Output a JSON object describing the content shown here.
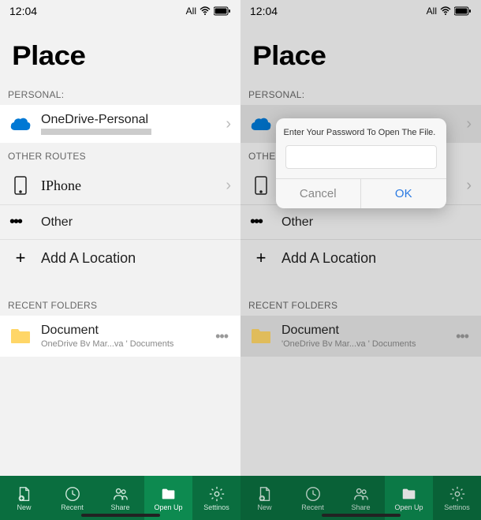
{
  "status": {
    "time": "12:04",
    "network_label": "All"
  },
  "title": "Place",
  "sections": {
    "personal": "PERSONAL:",
    "other_routes": "OTHER ROUTES",
    "recent": "RECENT FOLDERS"
  },
  "personal_item": {
    "title": "OneDrive-Personal"
  },
  "routes": {
    "iphone": "IPhone",
    "other": "Other",
    "add": "Add A Location"
  },
  "recent_item": {
    "title": "Document",
    "path": "OneDrive Bv Mar...va ' Documents",
    "path_right": "'OneDrive Bv Mar...va ' Documents"
  },
  "tabs": {
    "new": "New",
    "recent": "Recent",
    "share": "Share",
    "open": "Open Up",
    "settings": "Settinos"
  },
  "right_sections": {
    "other_routes": "OTHER"
  },
  "modal": {
    "message": "Enter Your Password To Open The File.",
    "cancel": "Cancel",
    "ok": "OK"
  }
}
